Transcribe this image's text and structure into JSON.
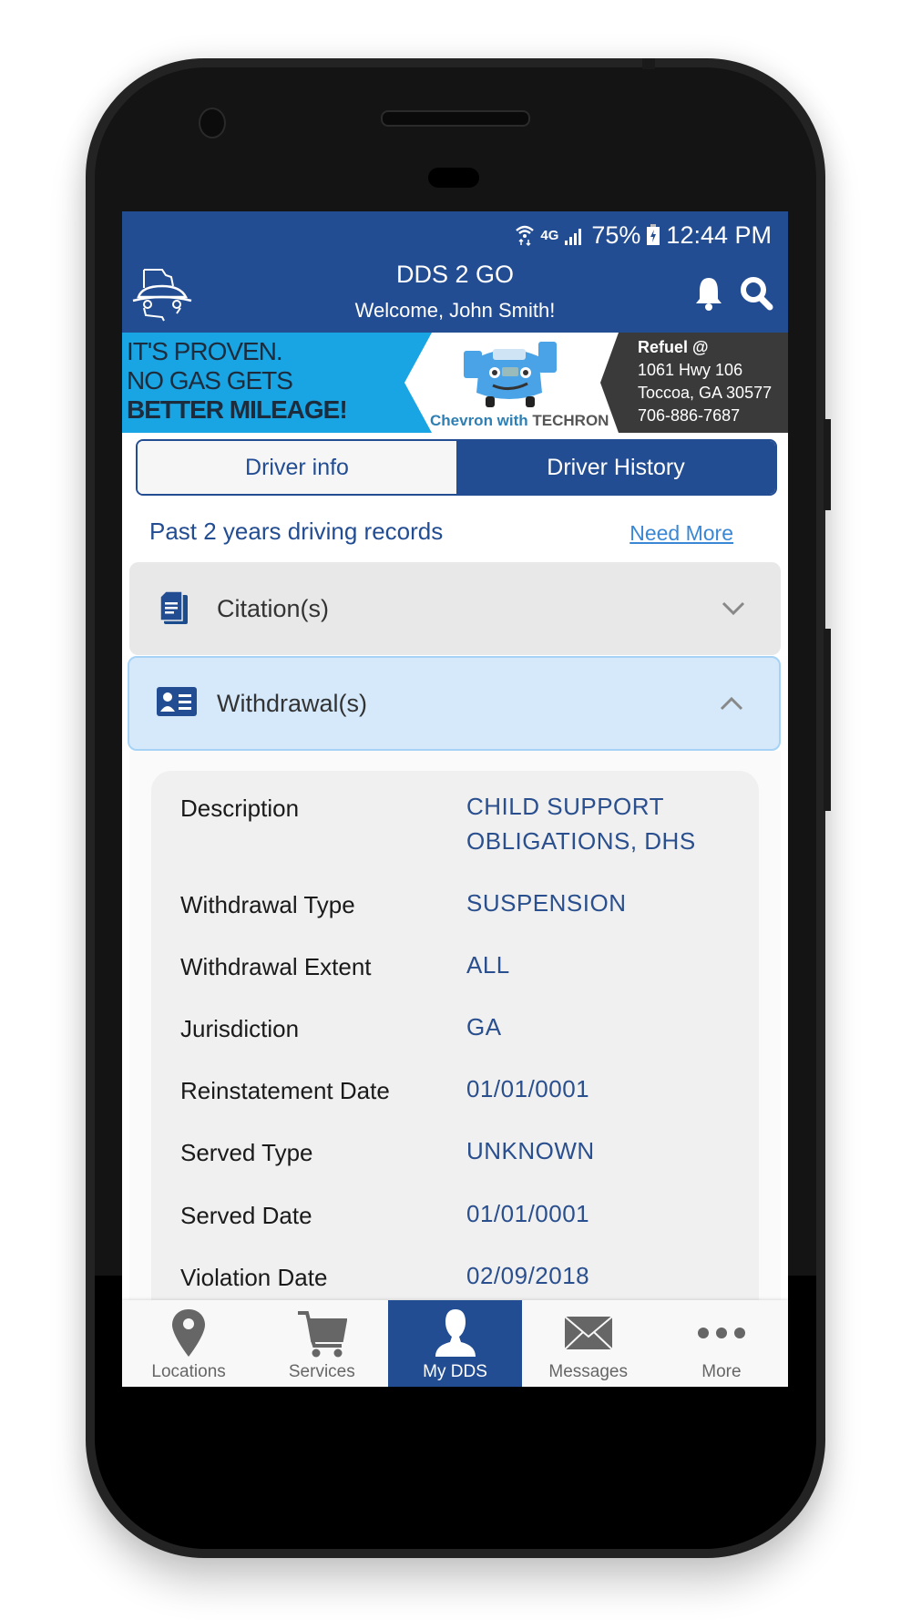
{
  "status_bar": {
    "network": "4G",
    "battery": "75%",
    "time": "12:44 PM"
  },
  "header": {
    "title": "DDS 2 GO",
    "subtitle": "Welcome, John Smith!",
    "icons": [
      "app-logo-icon",
      "bell-icon",
      "search-icon"
    ]
  },
  "ad": {
    "line1": "IT'S PROVEN.",
    "line2": "NO GAS GETS",
    "line3": "BETTER MILEAGE!",
    "brand_prefix": "Chevron with ",
    "brand_suffix": "TECHRON",
    "refuel": "Refuel @",
    "address1": "1061 Hwy 106",
    "address2": "Toccoa, GA 30577",
    "phone": "706-886-7687",
    "colors": {
      "left": "#19a4e3",
      "right": "#3a3a3a"
    }
  },
  "tabs": [
    {
      "label": "Driver info",
      "active": false
    },
    {
      "label": "Driver History",
      "active": true
    }
  ],
  "records": {
    "heading": "Past 2 years driving records",
    "link": "Need More"
  },
  "accordions": [
    {
      "label": "Citation(s)",
      "icon": "document-icon",
      "expanded": false
    },
    {
      "label": "Withdrawal(s)",
      "icon": "id-card-icon",
      "expanded": true
    }
  ],
  "withdrawal_details": [
    {
      "key": "Description",
      "value": "CHILD SUPPORT\nOBLIGATIONS, DHS"
    },
    {
      "key": "Withdrawal Type",
      "value": "SUSPENSION"
    },
    {
      "key": "Withdrawal Extent",
      "value": "ALL"
    },
    {
      "key": "Jurisdiction",
      "value": "GA"
    },
    {
      "key": "Reinstatement Date",
      "value": "01/01/0001"
    },
    {
      "key": "Served Type",
      "value": "UNKNOWN"
    },
    {
      "key": "Served Date",
      "value": "01/01/0001"
    },
    {
      "key": "Violation Date",
      "value": "02/09/2018"
    }
  ],
  "bottom_nav": [
    {
      "label": "Locations",
      "icon": "map-pin-icon",
      "active": false
    },
    {
      "label": "Services",
      "icon": "cart-icon",
      "active": false
    },
    {
      "label": "My DDS",
      "icon": "person-icon",
      "active": true
    },
    {
      "label": "Messages",
      "icon": "envelope-icon",
      "active": false
    },
    {
      "label": "More",
      "icon": "more-dots-icon",
      "active": false
    }
  ],
  "theme": {
    "primary": "#234d93",
    "link": "#3a87d6",
    "expanded_bg": "#d5e9fb"
  }
}
